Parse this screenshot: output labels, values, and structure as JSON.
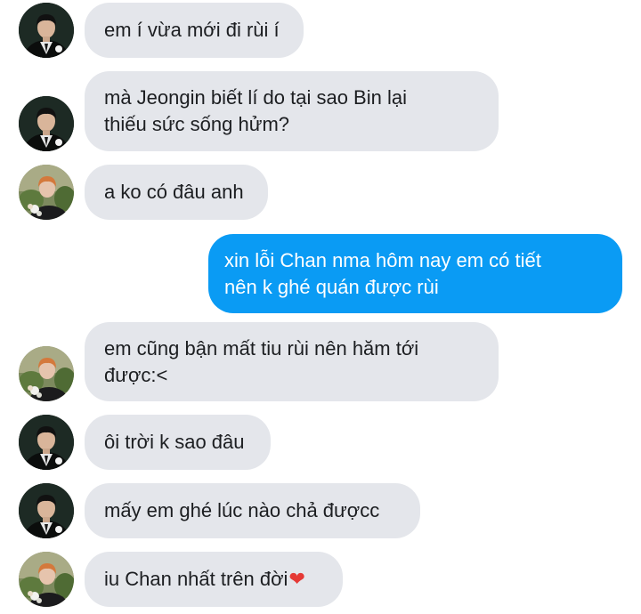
{
  "messages": [
    {
      "sender": "Chan",
      "direction": "incoming",
      "text": "em í vừa mới đi rùi í"
    },
    {
      "sender": "Chan",
      "direction": "incoming",
      "text": "mà Jeongin biết lí do tại sao Bin lại\nthiếu sức sống hửm?"
    },
    {
      "sender": "Jeongin",
      "direction": "incoming",
      "text": "a ko có đâu anh"
    },
    {
      "sender": "me",
      "direction": "outgoing",
      "text": "xin lỗi Chan nma hôm nay em có tiết\nnên k ghé quán được rùi"
    },
    {
      "sender": "Jeongin",
      "direction": "incoming",
      "text": "em cũng bận mất tiu rùi nên hăm tới\nđược:<"
    },
    {
      "sender": "Chan",
      "direction": "incoming",
      "text": "ôi trời k sao đâu"
    },
    {
      "sender": "Chan",
      "direction": "incoming",
      "text": "mấy em ghé lúc nào chả đượcc"
    },
    {
      "sender": "Jeongin",
      "direction": "incoming",
      "text": "iu Chan nhất trên đời",
      "emoji": "red-heart-icon"
    }
  ],
  "colors": {
    "incoming_bubble": "#e4e6eb",
    "outgoing_bubble": "#0a9bf4",
    "text": "#1c1e21",
    "heart": "#e53935"
  },
  "icons": {
    "heart_glyph": "❤"
  }
}
